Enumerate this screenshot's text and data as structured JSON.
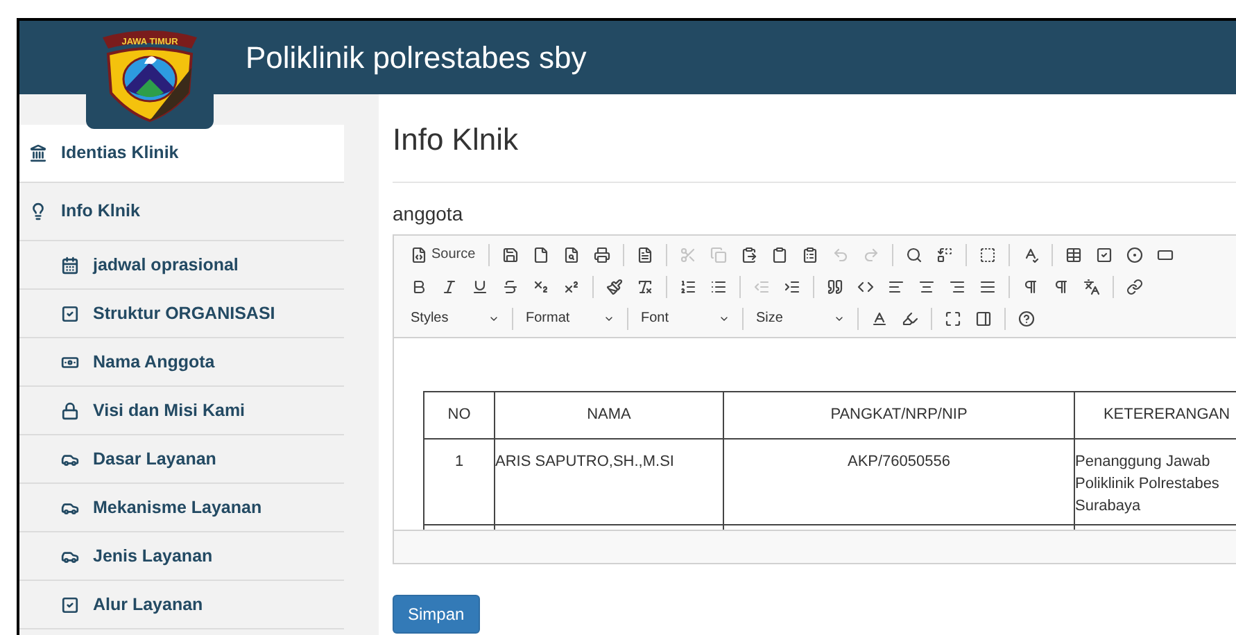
{
  "header": {
    "logo_text": "JAWA TIMUR",
    "title": "Poliklinik polrestabes sby"
  },
  "sidebar": {
    "items": [
      {
        "label": "Identias Klinik",
        "kind": "bank",
        "selected": true
      },
      {
        "label": "Info Klnik",
        "kind": "bulb",
        "selected": false,
        "children": [
          {
            "label": "jadwal oprasional",
            "kind": "calendar",
            "selected": false
          },
          {
            "label": "Struktur ORGANISASI",
            "kind": "check",
            "selected": false
          },
          {
            "label": "Nama Anggota",
            "kind": "money",
            "selected": false
          },
          {
            "label": "Visi dan Misi Kami",
            "kind": "lock",
            "selected": false
          },
          {
            "label": "Dasar Layanan",
            "kind": "car",
            "selected": false
          },
          {
            "label": "Mekanisme Layanan",
            "kind": "car",
            "selected": false
          },
          {
            "label": "Jenis Layanan",
            "kind": "car",
            "selected": false
          },
          {
            "label": "Alur Layanan",
            "kind": "check",
            "selected": false
          }
        ]
      }
    ]
  },
  "page": {
    "title": "Info Klnik",
    "field_label": "anggota"
  },
  "editor": {
    "toolbar": [
      [
        {
          "kind": "source",
          "label": "Source",
          "disabled": false
        },
        {
          "kind": "sep"
        },
        {
          "kind": "save",
          "disabled": false
        },
        {
          "kind": "new",
          "disabled": false
        },
        {
          "kind": "preview",
          "disabled": false
        },
        {
          "kind": "print",
          "disabled": false
        },
        {
          "kind": "sep"
        },
        {
          "kind": "template",
          "disabled": false
        },
        {
          "kind": "sep"
        },
        {
          "kind": "cut",
          "disabled": true
        },
        {
          "kind": "copy",
          "disabled": true
        },
        {
          "kind": "paste",
          "disabled": false
        },
        {
          "kind": "paste-text",
          "disabled": false
        },
        {
          "kind": "paste-word",
          "disabled": false
        },
        {
          "kind": "undo",
          "disabled": true
        },
        {
          "kind": "redo",
          "disabled": true
        },
        {
          "kind": "sep"
        },
        {
          "kind": "find",
          "disabled": false
        },
        {
          "kind": "replace",
          "disabled": false
        },
        {
          "kind": "sep"
        },
        {
          "kind": "select-all",
          "disabled": false
        },
        {
          "kind": "sep"
        },
        {
          "kind": "spellcheck",
          "disabled": false
        },
        {
          "kind": "sep"
        },
        {
          "kind": "form",
          "disabled": false
        },
        {
          "kind": "checkbox",
          "disabled": false
        },
        {
          "kind": "radio",
          "disabled": false
        },
        {
          "kind": "textfield",
          "disabled": false
        }
      ],
      [
        {
          "kind": "bold",
          "disabled": false
        },
        {
          "kind": "italic",
          "disabled": false
        },
        {
          "kind": "underline",
          "disabled": false
        },
        {
          "kind": "strike",
          "disabled": false
        },
        {
          "kind": "subscript",
          "disabled": false
        },
        {
          "kind": "superscript",
          "disabled": false
        },
        {
          "kind": "sep"
        },
        {
          "kind": "format-painter",
          "disabled": false
        },
        {
          "kind": "remove-format",
          "disabled": false
        },
        {
          "kind": "sep"
        },
        {
          "kind": "numbered-list",
          "disabled": false
        },
        {
          "kind": "bullet-list",
          "disabled": false
        },
        {
          "kind": "sep"
        },
        {
          "kind": "outdent",
          "disabled": true
        },
        {
          "kind": "indent",
          "disabled": false
        },
        {
          "kind": "sep"
        },
        {
          "kind": "blockquote",
          "disabled": false
        },
        {
          "kind": "div",
          "disabled": false
        },
        {
          "kind": "align-left",
          "disabled": false
        },
        {
          "kind": "align-center",
          "disabled": false
        },
        {
          "kind": "align-right",
          "disabled": false
        },
        {
          "kind": "justify",
          "disabled": false
        },
        {
          "kind": "sep"
        },
        {
          "kind": "ltr",
          "disabled": false
        },
        {
          "kind": "rtl",
          "disabled": false
        },
        {
          "kind": "language",
          "disabled": false
        },
        {
          "kind": "sep"
        },
        {
          "kind": "link",
          "disabled": false
        }
      ],
      [
        {
          "kind": "combo",
          "label": "Styles"
        },
        {
          "kind": "sep"
        },
        {
          "kind": "combo",
          "label": "Format"
        },
        {
          "kind": "sep"
        },
        {
          "kind": "combo",
          "label": "Font"
        },
        {
          "kind": "sep"
        },
        {
          "kind": "combo",
          "label": "Size"
        },
        {
          "kind": "sep"
        },
        {
          "kind": "text-color",
          "disabled": false
        },
        {
          "kind": "bg-color",
          "disabled": false
        },
        {
          "kind": "sep"
        },
        {
          "kind": "maximize",
          "disabled": false
        },
        {
          "kind": "blocks",
          "disabled": false
        },
        {
          "kind": "sep"
        },
        {
          "kind": "help",
          "disabled": false
        }
      ]
    ],
    "table": {
      "columns": [
        "NO",
        "NAMA",
        "PANGKAT/NRP/NIP",
        "KETERERANGAN"
      ],
      "rows": [
        [
          "1",
          "ARIS SAPUTRO,SH.,M.SI",
          "AKP/76050556",
          "Penanggung Jawab Poliklinik Polrestabes Surabaya"
        ]
      ]
    }
  },
  "save_button": "Simpan"
}
